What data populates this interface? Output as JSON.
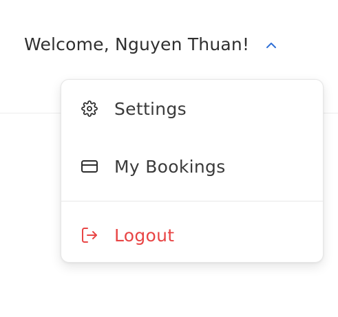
{
  "header": {
    "welcome_text": "Welcome, Nguyen Thuan!",
    "toggle_icon": "chevron-up-icon",
    "accent_color": "#2f6fd6"
  },
  "menu": {
    "items": [
      {
        "label": "Settings",
        "icon": "gear-icon"
      },
      {
        "label": "My Bookings",
        "icon": "credit-card-icon"
      }
    ],
    "logout": {
      "label": "Logout",
      "icon": "logout-icon",
      "color": "#e84545"
    }
  }
}
